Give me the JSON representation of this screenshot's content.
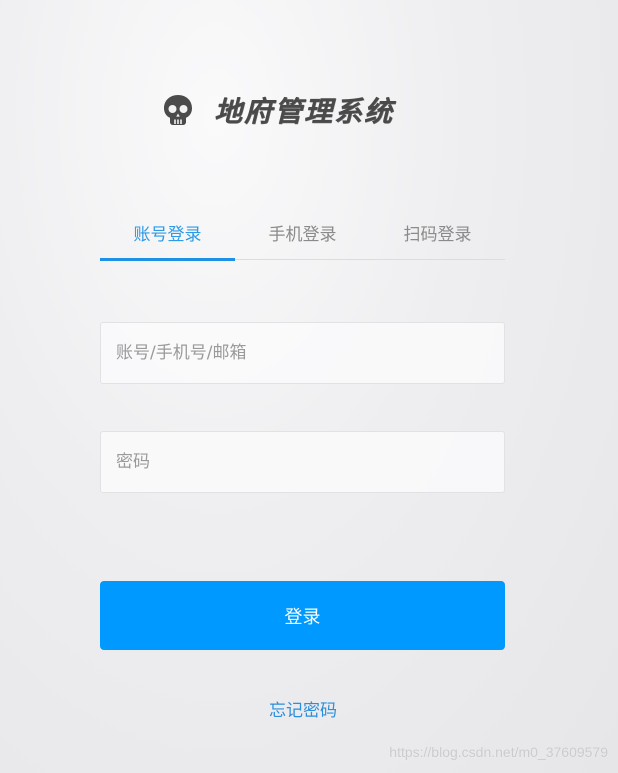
{
  "header": {
    "logo_icon": "skull-icon",
    "title": "地府管理系统"
  },
  "tabs": [
    {
      "label": "账号登录",
      "active": true
    },
    {
      "label": "手机登录",
      "active": false
    },
    {
      "label": "扫码登录",
      "active": false
    }
  ],
  "form": {
    "account": {
      "value": "",
      "placeholder": "账号/手机号/邮箱"
    },
    "password": {
      "value": "",
      "placeholder": "密码"
    },
    "login_label": "登录",
    "forgot_label": "忘记密码"
  },
  "watermark": "https://blog.csdn.net/m0_37609579",
  "colors": {
    "accent": "#0099ff",
    "tab_active": "#2c9ae6",
    "link": "#2a8fdc"
  }
}
